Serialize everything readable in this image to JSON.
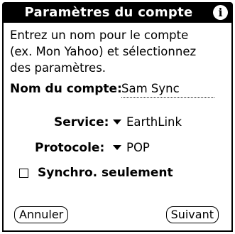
{
  "title_bar": {
    "title": "Paramètres du compte",
    "info_icon": "info-icon",
    "info_glyph": "i"
  },
  "instructions": "Entrez un nom pour le compte\n(ex. Mon Yahoo) et sélectionnez\ndes paramètres.",
  "account_name": {
    "label": "Nom du compte:",
    "value": "Sam Sync"
  },
  "service": {
    "label": "Service:",
    "selected": "EarthLink"
  },
  "protocol": {
    "label": "Protocole:",
    "selected": "POP"
  },
  "sync_only": {
    "label": "Synchro. seulement",
    "checked": false
  },
  "buttons": {
    "cancel": "Annuler",
    "next": "Suivant"
  }
}
